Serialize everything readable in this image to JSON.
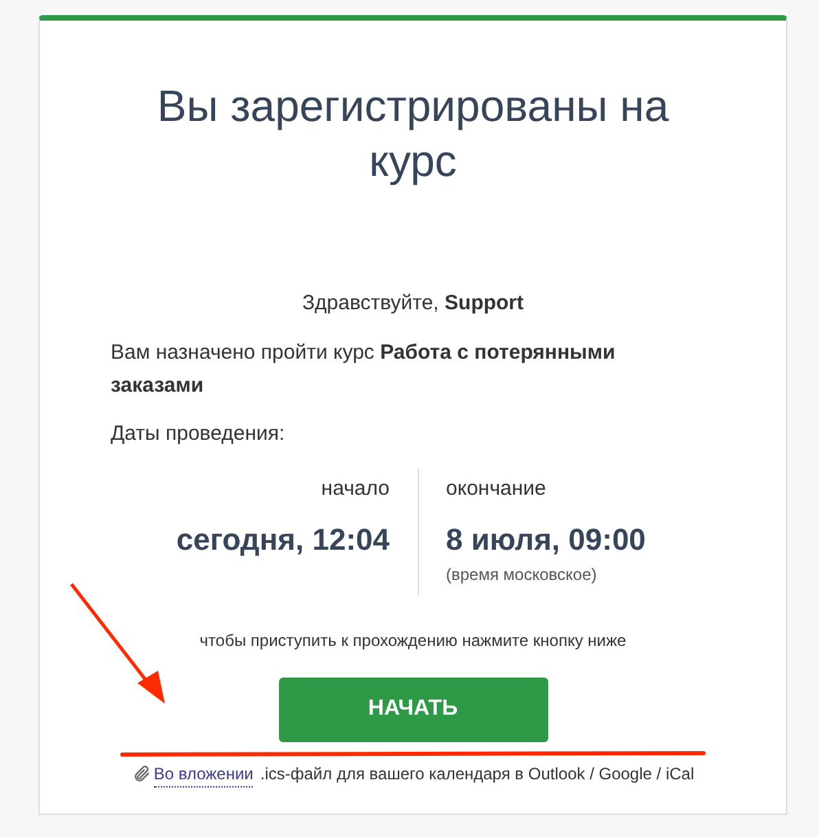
{
  "title": "Вы зарегистрированы на курс",
  "greeting": "Здравствуйте, **Support**",
  "assignment": "Вам назначено пройти курс **Работа с потерянными заказами**",
  "dates_label": "Даты проведения:",
  "dates": [
    {
      "label": "начало",
      "value": "сегодня, 12:04"
    },
    {
      "label": "окончание",
      "value": "8 июля, 09:00",
      "note": "(время московское)"
    }
  ],
  "hint": "чтобы приступить к прохождению нажмите кнопку ниже",
  "start_button": "НАЧАТЬ",
  "attachment": {
    "link": "Во вложении",
    "text": ".ics-файл для вашего календаря в Outlook / Google / iCal"
  }
}
